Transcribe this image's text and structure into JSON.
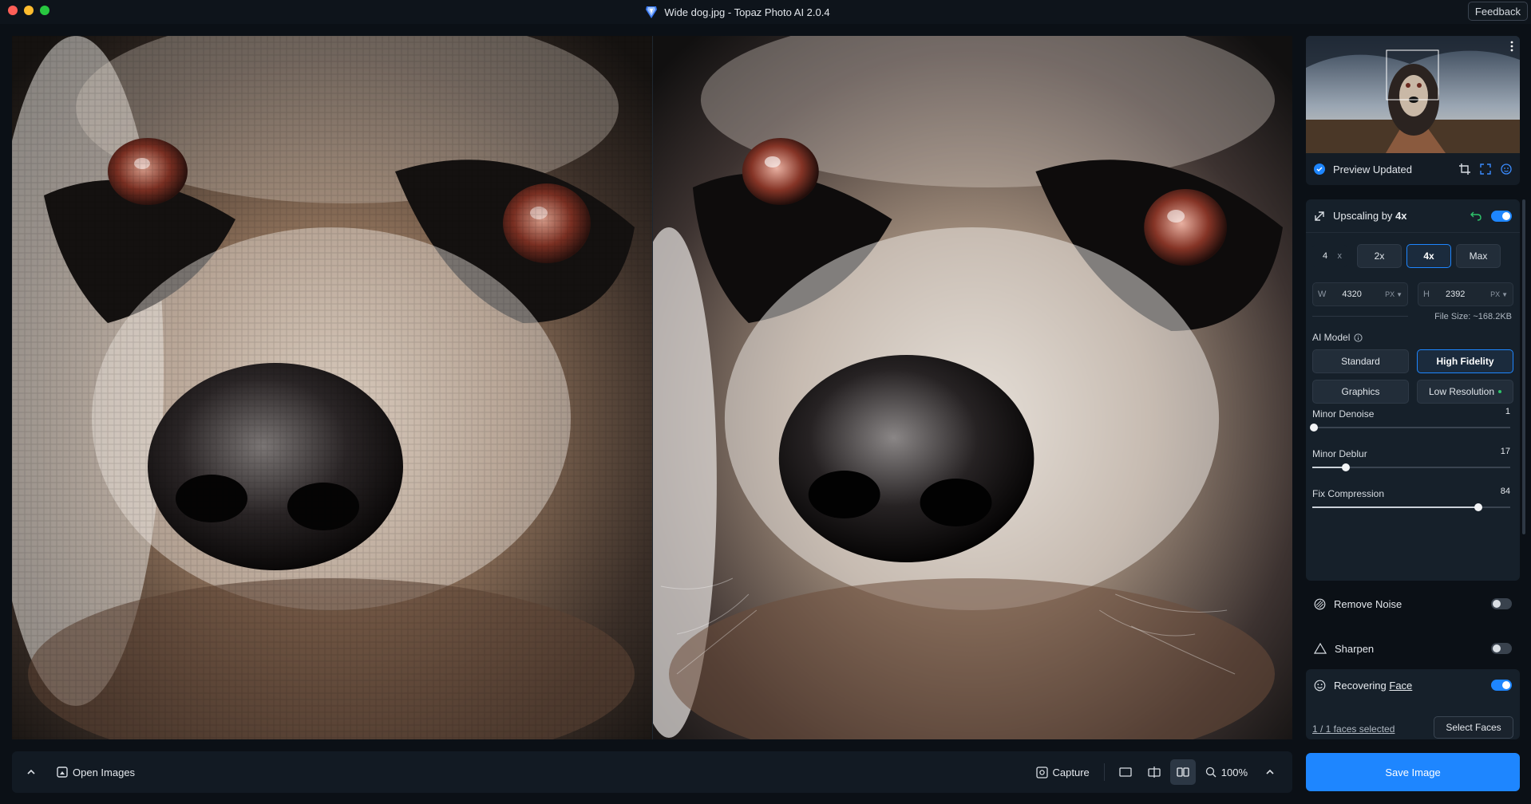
{
  "window": {
    "title": "Wide dog.jpg - Topaz Photo AI 2.0.4",
    "feedback_label": "Feedback"
  },
  "preview": {
    "status": "Preview Updated"
  },
  "upscale": {
    "title_prefix": "Upscaling by",
    "title_value": "4x",
    "scale_input": "4",
    "scale_unit": "x",
    "scale_options": [
      "2x",
      "4x",
      "Max"
    ],
    "selected_scale": "4x",
    "width_label": "W",
    "width_value": "4320",
    "width_unit": "PX",
    "height_label": "H",
    "height_value": "2392",
    "height_unit": "PX",
    "file_size": "File Size: ~168.2KB",
    "ai_model_label": "AI Model",
    "models": [
      "Standard",
      "High Fidelity",
      "Graphics",
      "Low Resolution"
    ],
    "selected_model": "High Fidelity",
    "sliders": [
      {
        "label": "Minor Denoise",
        "value": "1",
        "level": 0.01
      },
      {
        "label": "Minor Deblur",
        "value": "17",
        "level": 0.17
      },
      {
        "label": "Fix Compression",
        "value": "84",
        "level": 0.84
      }
    ],
    "enabled": true
  },
  "features": {
    "remove_noise": {
      "label": "Remove Noise",
      "enabled": false
    },
    "sharpen": {
      "label": "Sharpen",
      "enabled": false
    },
    "face": {
      "label_prefix": "Recovering",
      "label_link": "Face",
      "enabled": true,
      "faces_selected": "1 / 1 faces selected",
      "select_button": "Select Faces"
    }
  },
  "bottom": {
    "open_images": "Open Images",
    "capture": "Capture",
    "zoom": "100%"
  },
  "save_label": "Save Image",
  "colors": {
    "accent": "#1e86ff",
    "background": "#0b1016",
    "panel": "#16202a"
  }
}
